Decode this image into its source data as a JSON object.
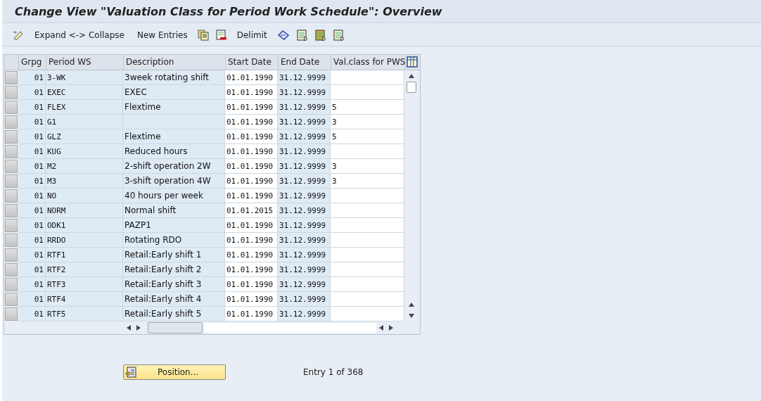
{
  "window": {
    "title": "Change View \"Valuation Class for Period Work Schedule\": Overview"
  },
  "toolbar": [
    {
      "kind": "icon"
    },
    {
      "kind": "text",
      "label": "Expand <-> Collapse"
    },
    {
      "kind": "text",
      "label": "New Entries"
    },
    {
      "kind": "icon"
    },
    {
      "kind": "icon"
    },
    {
      "kind": "text",
      "label": "Delimit"
    },
    {
      "kind": "icon"
    },
    {
      "kind": "icon"
    },
    {
      "kind": "icon"
    },
    {
      "kind": "icon"
    }
  ],
  "table": {
    "columns": [
      "Grpg",
      "Period WS",
      "Description",
      "Start Date",
      "End Date",
      "Val.class for PWS"
    ],
    "rows": [
      [
        "01",
        "3-WK",
        "3week rotating shift",
        "01.01.1990",
        "31.12.9999",
        ""
      ],
      [
        "01",
        "EXEC",
        "EXEC",
        "01.01.1990",
        "31.12.9999",
        ""
      ],
      [
        "01",
        "FLEX",
        "Flextime",
        "01.01.1990",
        "31.12.9999",
        "5"
      ],
      [
        "01",
        "G1",
        "",
        "01.01.1990",
        "31.12.9999",
        "3"
      ],
      [
        "01",
        "GLZ",
        "Flextime",
        "01.01.1990",
        "31.12.9999",
        "5"
      ],
      [
        "01",
        "KUG",
        "Reduced hours",
        "01.01.1990",
        "31.12.9999",
        ""
      ],
      [
        "01",
        "M2",
        "2-shift operation 2W",
        "01.01.1990",
        "31.12.9999",
        "3"
      ],
      [
        "01",
        "M3",
        "3-shift operation 4W",
        "01.01.1990",
        "31.12.9999",
        "3"
      ],
      [
        "01",
        "NO",
        "40 hours per week",
        "01.01.1990",
        "31.12.9999",
        ""
      ],
      [
        "01",
        "NORM",
        "Normal shift",
        "01.01.2015",
        "31.12.9999",
        ""
      ],
      [
        "01",
        "ODK1",
        "PAZP1",
        "01.01.1990",
        "31.12.9999",
        ""
      ],
      [
        "01",
        "RRDO",
        "Rotating RDO",
        "01.01.1990",
        "31.12.9999",
        ""
      ],
      [
        "01",
        "RTF1",
        "Retail:Early shift 1",
        "01.01.1990",
        "31.12.9999",
        ""
      ],
      [
        "01",
        "RTF2",
        "Retail:Early shift 2",
        "01.01.1990",
        "31.12.9999",
        ""
      ],
      [
        "01",
        "RTF3",
        "Retail:Early shift 3",
        "01.01.1990",
        "31.12.9999",
        ""
      ],
      [
        "01",
        "RTF4",
        "Retail:Early shift 4",
        "01.01.1990",
        "31.12.9999",
        ""
      ],
      [
        "01",
        "RTF5",
        "Retail:Early shift 5",
        "01.01.1990",
        "31.12.9999",
        ""
      ]
    ]
  },
  "position_button": {
    "label": "Position..."
  },
  "entry_info": "Entry 1 of 368"
}
